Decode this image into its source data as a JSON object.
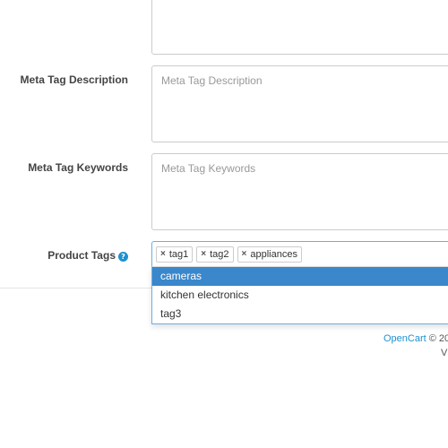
{
  "form": {
    "meta_description": {
      "label": "Meta Tag Description",
      "placeholder": "Meta Tag Description"
    },
    "meta_keywords": {
      "label": "Meta Tag Keywords",
      "placeholder": "Meta Tag Keywords"
    },
    "product_tags": {
      "label": "Product Tags",
      "help_icon": "question-circle-icon",
      "help_glyph": "?",
      "remove_glyph": "×",
      "tags": [
        "tag1",
        "tag2",
        "appliances"
      ],
      "suggestions": [
        {
          "label": "cameras",
          "active": true
        },
        {
          "label": "kitchen electronics",
          "active": false
        },
        {
          "label": "tag3",
          "active": false
        }
      ]
    }
  },
  "footer": {
    "brand_link": "OpenCart",
    "copyright": " © 20",
    "version": "V"
  },
  "colors": {
    "accent": "#1e91cf",
    "active_item": "#3a87cc",
    "focus_border": "#66afe9"
  }
}
